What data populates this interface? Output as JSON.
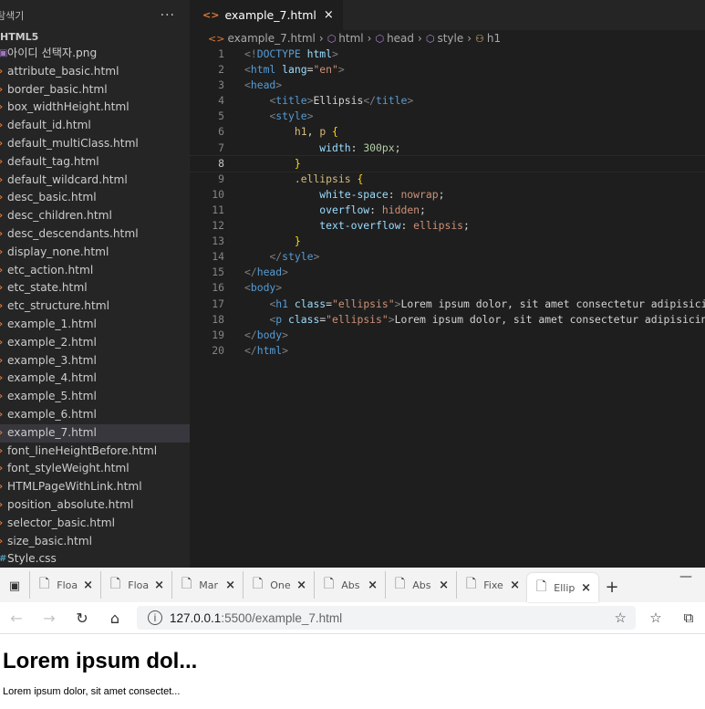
{
  "explorer": {
    "title": "탐색기",
    "more": "···",
    "folder": "HTML5",
    "files": [
      {
        "label": "아이디 선택자.png",
        "kind": "img"
      },
      {
        "label": "attribute_basic.html",
        "kind": "html"
      },
      {
        "label": "border_basic.html",
        "kind": "html"
      },
      {
        "label": "box_widthHeight.html",
        "kind": "html"
      },
      {
        "label": "default_id.html",
        "kind": "html"
      },
      {
        "label": "default_multiClass.html",
        "kind": "html"
      },
      {
        "label": "default_tag.html",
        "kind": "html"
      },
      {
        "label": "default_wildcard.html",
        "kind": "html"
      },
      {
        "label": "desc_basic.html",
        "kind": "html"
      },
      {
        "label": "desc_children.html",
        "kind": "html"
      },
      {
        "label": "desc_descendants.html",
        "kind": "html"
      },
      {
        "label": "display_none.html",
        "kind": "html"
      },
      {
        "label": "etc_action.html",
        "kind": "html"
      },
      {
        "label": "etc_state.html",
        "kind": "html"
      },
      {
        "label": "etc_structure.html",
        "kind": "html"
      },
      {
        "label": "example_1.html",
        "kind": "html"
      },
      {
        "label": "example_2.html",
        "kind": "html"
      },
      {
        "label": "example_3.html",
        "kind": "html"
      },
      {
        "label": "example_4.html",
        "kind": "html"
      },
      {
        "label": "example_5.html",
        "kind": "html"
      },
      {
        "label": "example_6.html",
        "kind": "html"
      },
      {
        "label": "example_7.html",
        "kind": "html",
        "active": true
      },
      {
        "label": "font_lineHeightBefore.html",
        "kind": "html"
      },
      {
        "label": "font_styleWeight.html",
        "kind": "html"
      },
      {
        "label": "HTMLPageWithLink.html",
        "kind": "html"
      },
      {
        "label": "position_absolute.html",
        "kind": "html"
      },
      {
        "label": "selector_basic.html",
        "kind": "html"
      },
      {
        "label": "size_basic.html",
        "kind": "html"
      },
      {
        "label": "Style.css",
        "kind": "css"
      }
    ]
  },
  "editor": {
    "tab_label": "example_7.html",
    "tab_close": "×",
    "breadcrumb": [
      "example_7.html",
      "html",
      "head",
      "style",
      "h1"
    ],
    "current_line": 8,
    "lines": [
      [
        [
          "t-punc",
          "<!"
        ],
        [
          "t-tag",
          "DOCTYPE"
        ],
        [
          "t-text",
          " "
        ],
        [
          "t-attr",
          "html"
        ],
        [
          "t-punc",
          ">"
        ]
      ],
      [
        [
          "t-punc",
          "<"
        ],
        [
          "t-tag",
          "html"
        ],
        [
          "t-text",
          " "
        ],
        [
          "t-attr",
          "lang"
        ],
        [
          "t-text",
          "="
        ],
        [
          "t-str",
          "\"en\""
        ],
        [
          "t-punc",
          ">"
        ]
      ],
      [
        [
          "t-punc",
          "<"
        ],
        [
          "t-tag",
          "head"
        ],
        [
          "t-punc",
          ">"
        ]
      ],
      [
        [
          "t-text",
          "    "
        ],
        [
          "t-punc",
          "<"
        ],
        [
          "t-tag",
          "title"
        ],
        [
          "t-punc",
          ">"
        ],
        [
          "t-text",
          "Ellipsis"
        ],
        [
          "t-punc",
          "</"
        ],
        [
          "t-tag",
          "title"
        ],
        [
          "t-punc",
          ">"
        ]
      ],
      [
        [
          "t-text",
          "    "
        ],
        [
          "t-punc",
          "<"
        ],
        [
          "t-tag",
          "style"
        ],
        [
          "t-punc",
          ">"
        ]
      ],
      [
        [
          "t-text",
          "        "
        ],
        [
          "t-sel",
          "h1"
        ],
        [
          "t-text",
          ", "
        ],
        [
          "t-sel",
          "p"
        ],
        [
          "t-text",
          " "
        ],
        [
          "t-brace",
          "{"
        ]
      ],
      [
        [
          "t-text",
          "            "
        ],
        [
          "t-prop",
          "width"
        ],
        [
          "t-text",
          ": "
        ],
        [
          "t-num",
          "300px"
        ],
        [
          "t-text",
          ";"
        ]
      ],
      [
        [
          "t-text",
          "        "
        ],
        [
          "t-brace",
          "}"
        ]
      ],
      [
        [
          "t-text",
          "        "
        ],
        [
          "t-sel",
          ".ellipsis"
        ],
        [
          "t-text",
          " "
        ],
        [
          "t-brace",
          "{"
        ]
      ],
      [
        [
          "t-text",
          "            "
        ],
        [
          "t-prop",
          "white-space"
        ],
        [
          "t-text",
          ": "
        ],
        [
          "t-str",
          "nowrap"
        ],
        [
          "t-text",
          ";"
        ]
      ],
      [
        [
          "t-text",
          "            "
        ],
        [
          "t-prop",
          "overflow"
        ],
        [
          "t-text",
          ": "
        ],
        [
          "t-str",
          "hidden"
        ],
        [
          "t-text",
          ";"
        ]
      ],
      [
        [
          "t-text",
          "            "
        ],
        [
          "t-prop",
          "text-overflow"
        ],
        [
          "t-text",
          ": "
        ],
        [
          "t-str",
          "ellipsis"
        ],
        [
          "t-text",
          ";"
        ]
      ],
      [
        [
          "t-text",
          "        "
        ],
        [
          "t-brace",
          "}"
        ]
      ],
      [
        [
          "t-text",
          "    "
        ],
        [
          "t-punc",
          "</"
        ],
        [
          "t-tag",
          "style"
        ],
        [
          "t-punc",
          ">"
        ]
      ],
      [
        [
          "t-punc",
          "</"
        ],
        [
          "t-tag",
          "head"
        ],
        [
          "t-punc",
          ">"
        ]
      ],
      [
        [
          "t-punc",
          "<"
        ],
        [
          "t-tag",
          "body"
        ],
        [
          "t-punc",
          ">"
        ]
      ],
      [
        [
          "t-text",
          "    "
        ],
        [
          "t-punc",
          "<"
        ],
        [
          "t-tag",
          "h1"
        ],
        [
          "t-text",
          " "
        ],
        [
          "t-attr",
          "class"
        ],
        [
          "t-text",
          "="
        ],
        [
          "t-str",
          "\"ellipsis\""
        ],
        [
          "t-punc",
          ">"
        ],
        [
          "t-text",
          "Lorem ipsum dolor, sit amet consectetur adipisicing elit"
        ]
      ],
      [
        [
          "t-text",
          "    "
        ],
        [
          "t-punc",
          "<"
        ],
        [
          "t-tag",
          "p"
        ],
        [
          "t-text",
          " "
        ],
        [
          "t-attr",
          "class"
        ],
        [
          "t-text",
          "="
        ],
        [
          "t-str",
          "\"ellipsis\""
        ],
        [
          "t-punc",
          ">"
        ],
        [
          "t-text",
          "Lorem ipsum dolor, sit amet consectetur adipisicing elit"
        ]
      ],
      [
        [
          "t-punc",
          "</"
        ],
        [
          "t-tag",
          "body"
        ],
        [
          "t-punc",
          ">"
        ]
      ],
      [
        [
          "t-punc",
          "</"
        ],
        [
          "t-tag",
          "html"
        ],
        [
          "t-punc",
          ">"
        ]
      ]
    ]
  },
  "browser": {
    "tabs": [
      {
        "title": "Floa",
        "active": false
      },
      {
        "title": "Floa",
        "active": false
      },
      {
        "title": "Mar",
        "active": false
      },
      {
        "title": "One",
        "active": false
      },
      {
        "title": "Abs",
        "active": false
      },
      {
        "title": "Abs",
        "active": false
      },
      {
        "title": "Fixe",
        "active": false
      },
      {
        "title": "Ellip",
        "active": true
      }
    ],
    "tab_close": "×",
    "new_tab": "+",
    "minimize": "—",
    "url_host": "127.0.0.1",
    "url_rest": ":5500/example_7.html",
    "page_h1": "Lorem ipsum dol...",
    "page_p": "Lorem ipsum dolor, sit amet consectet..."
  }
}
